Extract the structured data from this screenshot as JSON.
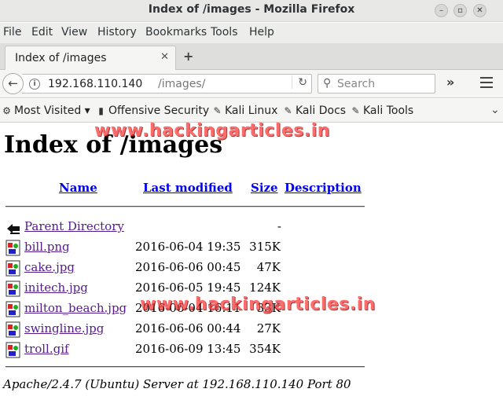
{
  "window": {
    "title": "Index of /images - Mozilla Firefox"
  },
  "menu": [
    "File",
    "Edit",
    "View",
    "History",
    "Bookmarks",
    "Tools",
    "Help"
  ],
  "tab": {
    "label": "Index of /images",
    "close": "✕"
  },
  "address_bar": {
    "host": "192.168.110.140",
    "path": "/images/"
  },
  "search": {
    "placeholder": "Search"
  },
  "bookmarks": [
    {
      "label": "Most Visited ▾",
      "icon": "gear-icon"
    },
    {
      "label": "Offensive Security",
      "icon": "offsec-icon"
    },
    {
      "label": "Kali Linux",
      "icon": "kali-icon"
    },
    {
      "label": "Kali Docs",
      "icon": "kali-icon"
    },
    {
      "label": "Kali Tools",
      "icon": "kali-icon"
    }
  ],
  "page": {
    "heading": "Index of /images",
    "columns": {
      "name": "Name",
      "last_modified": "Last modified",
      "size": "Size",
      "description": "Description"
    },
    "parent": {
      "name": "Parent Directory",
      "size": "-"
    },
    "files": [
      {
        "name": "bill.png",
        "date": "2016-06-04 19:35",
        "size": "315K"
      },
      {
        "name": "cake.jpg",
        "date": "2016-06-06 00:45",
        "size": "47K"
      },
      {
        "name": "initech.jpg",
        "date": "2016-06-05 19:45",
        "size": "124K"
      },
      {
        "name": "milton_beach.jpg",
        "date": "2016-06-04 16:11",
        "size": "33K"
      },
      {
        "name": "swingline.jpg",
        "date": "2016-06-06 00:44",
        "size": "27K"
      },
      {
        "name": "troll.gif",
        "date": "2016-06-09 13:45",
        "size": "354K"
      }
    ],
    "address": "Apache/2.4.7 (Ubuntu) Server at 192.168.110.140 Port 80"
  },
  "watermark": "www.hackingarticles.in",
  "colors": {
    "link": "#00e",
    "visited_link": "#551a8b",
    "watermark": "#ff3b3b"
  }
}
